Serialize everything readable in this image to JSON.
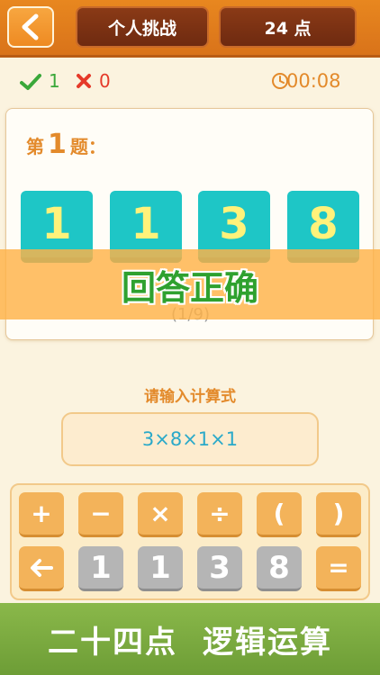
{
  "header": {
    "mode_tab": "个人挑战",
    "game_tab": "24 点"
  },
  "status": {
    "correct_count": "1",
    "wrong_count": "0",
    "timer": "00:08"
  },
  "question": {
    "prefix": "第",
    "number": "1",
    "suffix": "题：",
    "tiles": [
      "1",
      "1",
      "3",
      "8"
    ],
    "progress": "(1/9)"
  },
  "result_banner": "回答正确",
  "input": {
    "prompt": "请输入计算式",
    "expression": "3×8×1×1"
  },
  "keypad": {
    "ops": [
      "+",
      "−",
      "×",
      "÷",
      "(",
      ")"
    ],
    "numbers": [
      "1",
      "1",
      "3",
      "8"
    ],
    "equals": "="
  },
  "footer": {
    "left": "二十四点",
    "right": "逻辑运算"
  },
  "colors": {
    "header": "#e8871f",
    "tile": "#1ec6c6",
    "tile_text": "#fff27a",
    "correct": "#3aa83a",
    "wrong": "#e53a2a",
    "accent": "#e38a2b",
    "footer": "#7aab3f"
  },
  "icons": [
    "back-arrow-icon",
    "check-icon",
    "cross-icon",
    "clock-icon",
    "backspace-arrow-icon"
  ]
}
